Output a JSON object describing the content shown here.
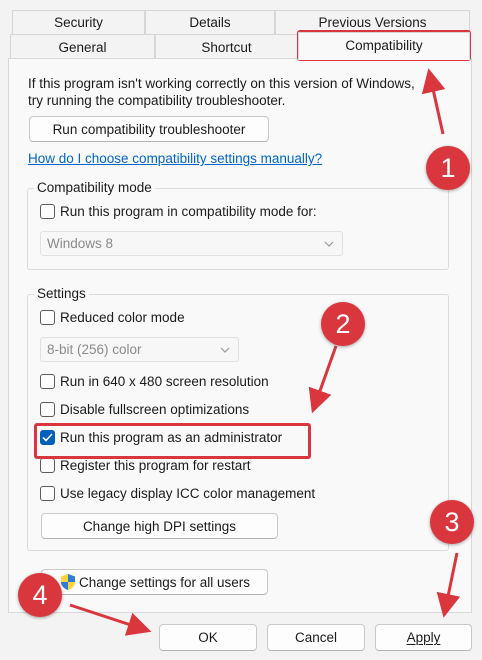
{
  "tabs": {
    "row1": [
      "Security",
      "Details",
      "Previous Versions"
    ],
    "row2": [
      "General",
      "Shortcut",
      "Compatibility"
    ],
    "active": "Compatibility"
  },
  "intro_text": "If this program isn't working correctly on this version of Windows, try running the compatibility troubleshooter.",
  "troubleshooter_button": "Run compatibility troubleshooter",
  "help_link": "How do I choose compatibility settings manually?",
  "compat_mode": {
    "title": "Compatibility mode",
    "checkbox_label": "Run this program in compatibility mode for:",
    "checked": false,
    "select_value": "Windows 8"
  },
  "settings": {
    "title": "Settings",
    "reduced_color": {
      "label": "Reduced color mode",
      "checked": false
    },
    "color_select_value": "8-bit (256) color",
    "resolution": {
      "label": "Run in 640 x 480 screen resolution",
      "checked": false
    },
    "fullscreen": {
      "label": "Disable fullscreen optimizations",
      "checked": false
    },
    "admin": {
      "label": "Run this program as an administrator",
      "checked": true
    },
    "restart": {
      "label": "Register this program for restart",
      "checked": false
    },
    "icc": {
      "label": "Use legacy display ICC color management",
      "checked": false
    },
    "dpi_button": "Change high DPI settings"
  },
  "all_users_button": "Change settings for all users",
  "footer": {
    "ok": "OK",
    "cancel": "Cancel",
    "apply": "Apply"
  },
  "annotations": {
    "badge_1": "1",
    "badge_2": "2",
    "badge_3": "3",
    "badge_4": "4",
    "color": "#d9363e"
  },
  "icons": {
    "shield": "uac-shield-icon",
    "checkmark": "checkmark-icon",
    "dropdown": "chevron-down-icon"
  }
}
